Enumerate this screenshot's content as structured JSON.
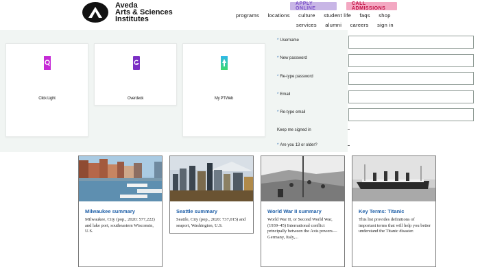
{
  "header": {
    "brand_lines": [
      "Aveda",
      "Arts & Sciences",
      "Institutes"
    ],
    "apply_online": "APPLY ONLINE",
    "call_admissions": "CALL ADMISSIONS",
    "nav_row1": [
      "programs",
      "locations",
      "culture",
      "student life",
      "faqs",
      "shop"
    ],
    "nav_row2": [
      "services",
      "alumni",
      "careers",
      "sign in"
    ]
  },
  "apps": [
    {
      "label": "Click Light",
      "icon": "q-app-icon"
    },
    {
      "label": "Overdeck",
      "icon": "g-app-icon"
    },
    {
      "label": "My PTWeb",
      "icon": "arrow-app-icon"
    }
  ],
  "form": {
    "fields": [
      {
        "label": "Username",
        "required": true
      },
      {
        "label": "New password",
        "required": true
      },
      {
        "label": "Re-type password",
        "required": true
      },
      {
        "label": "Email",
        "required": true
      },
      {
        "label": "Re-type email",
        "required": true
      }
    ],
    "keep_signed_in": "Keep me signed in",
    "age_question": "Are you 13 or older?"
  },
  "articles": [
    {
      "title": "Milwaukee summary",
      "desc": "Milwaukee, City (pop., 2020: 577,222) and lake port, southeastern Wisconsin, U.S."
    },
    {
      "title": "Seattle summary",
      "desc": "Seattle, City (pop., 2020: 737,015) and seaport, Washington, U.S."
    },
    {
      "title": "World War II summary",
      "desc": "World War II, or Second World War, (1939–45) International conflict principally between the Axis powers—Germany, Italy,..."
    },
    {
      "title": "Key Terms: Titanic",
      "desc": "This list provides definitions of important terms that will help you better understand the Titanic disaster."
    }
  ],
  "colors": {
    "accent_blue": "#1d5ea7",
    "apply_bg": "#c8b6e6",
    "admissions_bg": "#f3a8c2"
  }
}
